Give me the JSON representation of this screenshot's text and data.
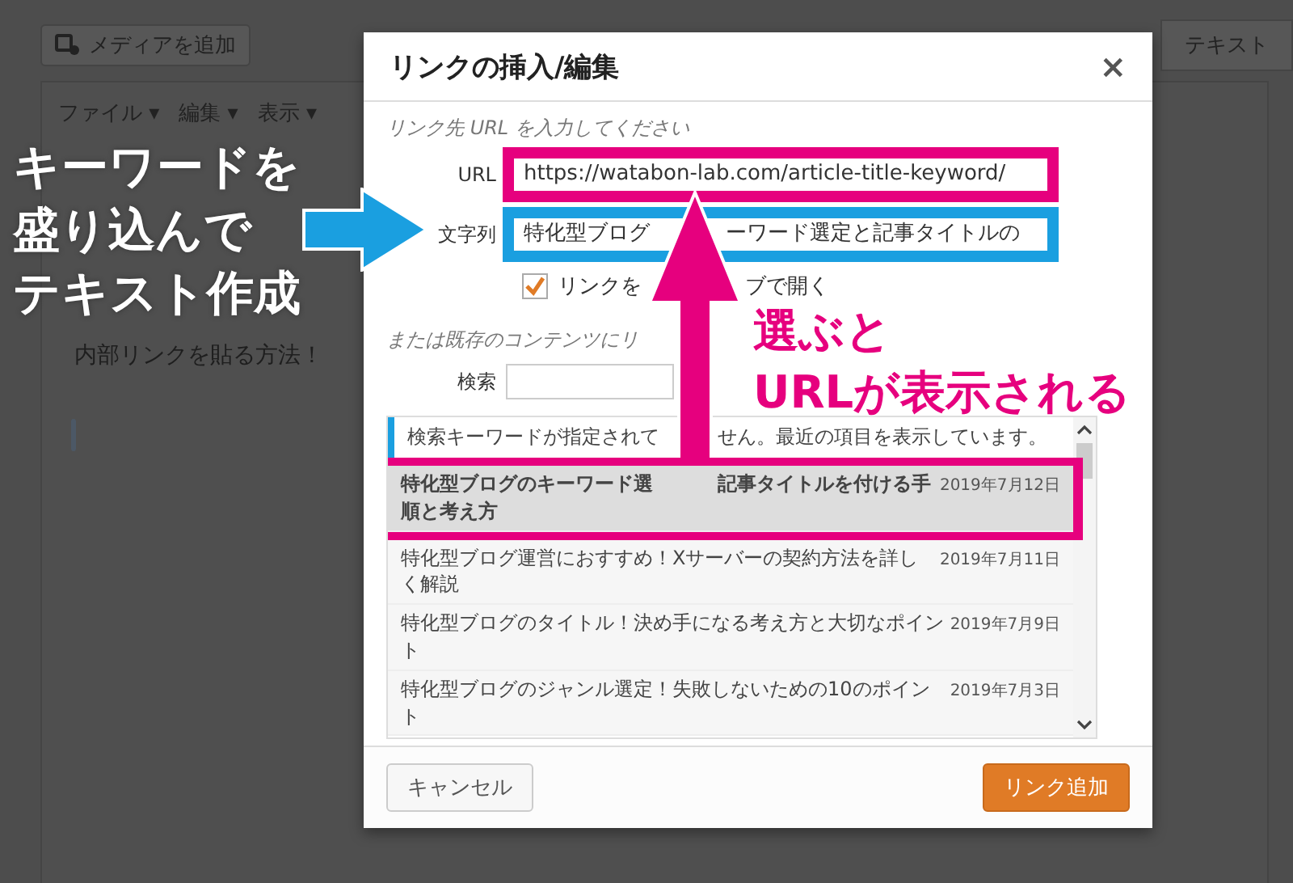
{
  "editor": {
    "media_button": "メディアを追加",
    "text_tab": "テキスト",
    "menus": [
      {
        "label": "ファイル",
        "caret": "▾"
      },
      {
        "label": "編集",
        "caret": "▾"
      },
      {
        "label": "表示",
        "caret": "▾"
      }
    ],
    "content": "内部リンクを貼る方法！"
  },
  "dialog": {
    "title": "リンクの挿入/編集",
    "close": "×",
    "url_hint": "リンク先 URL を入力してください",
    "fields": [
      {
        "label": "URL",
        "value_parts": [
          "https://watabon-lab.com/article-title-keyword/"
        ],
        "color": "#e6007e"
      },
      {
        "label": "文字列",
        "value_parts": [
          "特化型ブログ",
          "ーワード選定と記事タイトルの"
        ],
        "color": "#1a9fe0"
      }
    ],
    "new_tab": {
      "label_parts": [
        "リンクを",
        "ブで開く"
      ],
      "checked": true
    },
    "existing_hint": "または既存のコンテンツにリ",
    "search_label": "検索",
    "notice_parts": [
      "検索キーワードが指定されて",
      "せん。最近の項目を表示しています。"
    ],
    "results": [
      {
        "title_parts": [
          "特化型ブログのキーワード選",
          "記事タイトルを付ける手順と考え方"
        ],
        "date": "2019年7月12日",
        "selected": true
      },
      {
        "title_parts": [
          "特化型ブログ運営におすすめ！Xサーバーの契約方法を詳しく解説"
        ],
        "date": "2019年7月11日",
        "selected": false
      },
      {
        "title_parts": [
          "特化型ブログのタイトル！決め手になる考え方と大切なポイント"
        ],
        "date": "2019年7月9日",
        "selected": false
      },
      {
        "title_parts": [
          "特化型ブログのジャンル選定！失敗しないための10のポイント"
        ],
        "date": "2019年7月3日",
        "selected": false
      }
    ],
    "buttons": [
      {
        "label": "キャンセル",
        "kind": "secondary"
      },
      {
        "label": "リンク追加",
        "kind": "primary"
      }
    ]
  },
  "annotations": {
    "left_note": [
      "キーワードを",
      "盛り込んで",
      "テキスト作成"
    ],
    "right_note": [
      "選ぶと",
      "URLが表示される"
    ]
  }
}
